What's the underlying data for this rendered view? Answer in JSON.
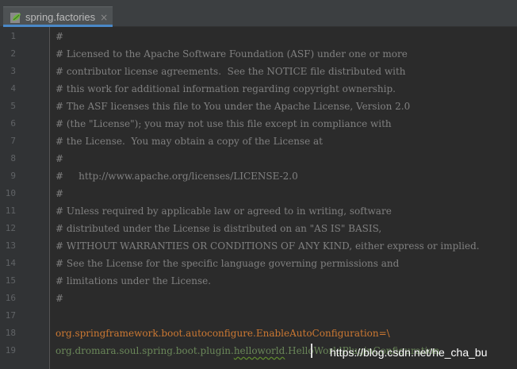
{
  "tab": {
    "label": "spring.factories",
    "close": "×",
    "icon": "spring-leaf-icon"
  },
  "lines": [
    {
      "num": "1",
      "text": "#"
    },
    {
      "num": "2",
      "text": "# Licensed to the Apache Software Foundation (ASF) under one or more"
    },
    {
      "num": "3",
      "text": "# contributor license agreements.  See the NOTICE file distributed with"
    },
    {
      "num": "4",
      "text": "# this work for additional information regarding copyright ownership."
    },
    {
      "num": "5",
      "text": "# The ASF licenses this file to You under the Apache License, Version 2.0"
    },
    {
      "num": "6",
      "text": "# (the \"License\"); you may not use this file except in compliance with"
    },
    {
      "num": "7",
      "text": "# the License.  You may obtain a copy of the License at"
    },
    {
      "num": "8",
      "text": "#"
    },
    {
      "num": "9",
      "text": "#     http://www.apache.org/licenses/LICENSE-2.0"
    },
    {
      "num": "10",
      "text": "#"
    },
    {
      "num": "11",
      "text": "# Unless required by applicable law or agreed to in writing, software"
    },
    {
      "num": "12",
      "text": "# distributed under the License is distributed on an \"AS IS\" BASIS,"
    },
    {
      "num": "13",
      "text": "# WITHOUT WARRANTIES OR CONDITIONS OF ANY KIND, either express or implied."
    },
    {
      "num": "14",
      "text": "# See the License for the specific language governing permissions and"
    },
    {
      "num": "15",
      "text": "# limitations under the License."
    },
    {
      "num": "16",
      "text": "#"
    },
    {
      "num": "17",
      "text": ""
    },
    {
      "num": "18",
      "text": "org.springframework.boot.autoconfigure.EnableAutoConfiguration=\\"
    },
    {
      "num": "19",
      "prefix": "org.dromara.soul.spring.boot.plugin.",
      "squiggle": "helloworld",
      "suffix": ".HelloWorldPluginConfiguration"
    }
  ],
  "watermark": "https://blog.csdn.net/he_cha_bu",
  "colors": {
    "background": "#2b2b2b",
    "gutter": "#313335",
    "comment": "#808080",
    "key": "#cc7832",
    "value": "#6a8759",
    "tab_accent": "#4a88c7"
  }
}
